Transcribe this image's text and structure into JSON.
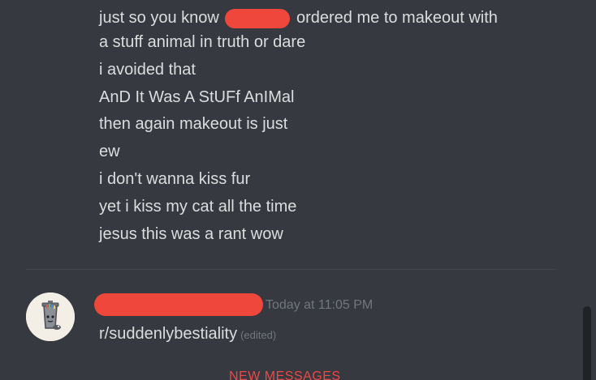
{
  "messages": {
    "lines": [
      {
        "before": "just so you know",
        "after": "ordered me to makeout with"
      },
      {
        "text": "a stuff animal in truth or dare"
      },
      {
        "text": "i avoided that"
      },
      {
        "text": "AnD It Was A StUFf AnIMal"
      },
      {
        "text": "then again makeout is just"
      },
      {
        "text": "ew"
      },
      {
        "text": "i don't wanna kiss fur"
      },
      {
        "text": "yet i kiss my cat all the time"
      },
      {
        "text": "jesus this was a rant wow"
      }
    ]
  },
  "next_message": {
    "timestamp": "Today at 11:05 PM",
    "content": "r/suddenlybestiality",
    "edited_label": "(edited)"
  },
  "divider_label": "NEW MESSAGES",
  "colors": {
    "background": "#36393f",
    "text": "#dcddde",
    "muted": "#72767d",
    "redaction": "#f0473d",
    "new_messages": "#f04747"
  },
  "icons": {
    "avatar": "trash-can-avatar"
  }
}
